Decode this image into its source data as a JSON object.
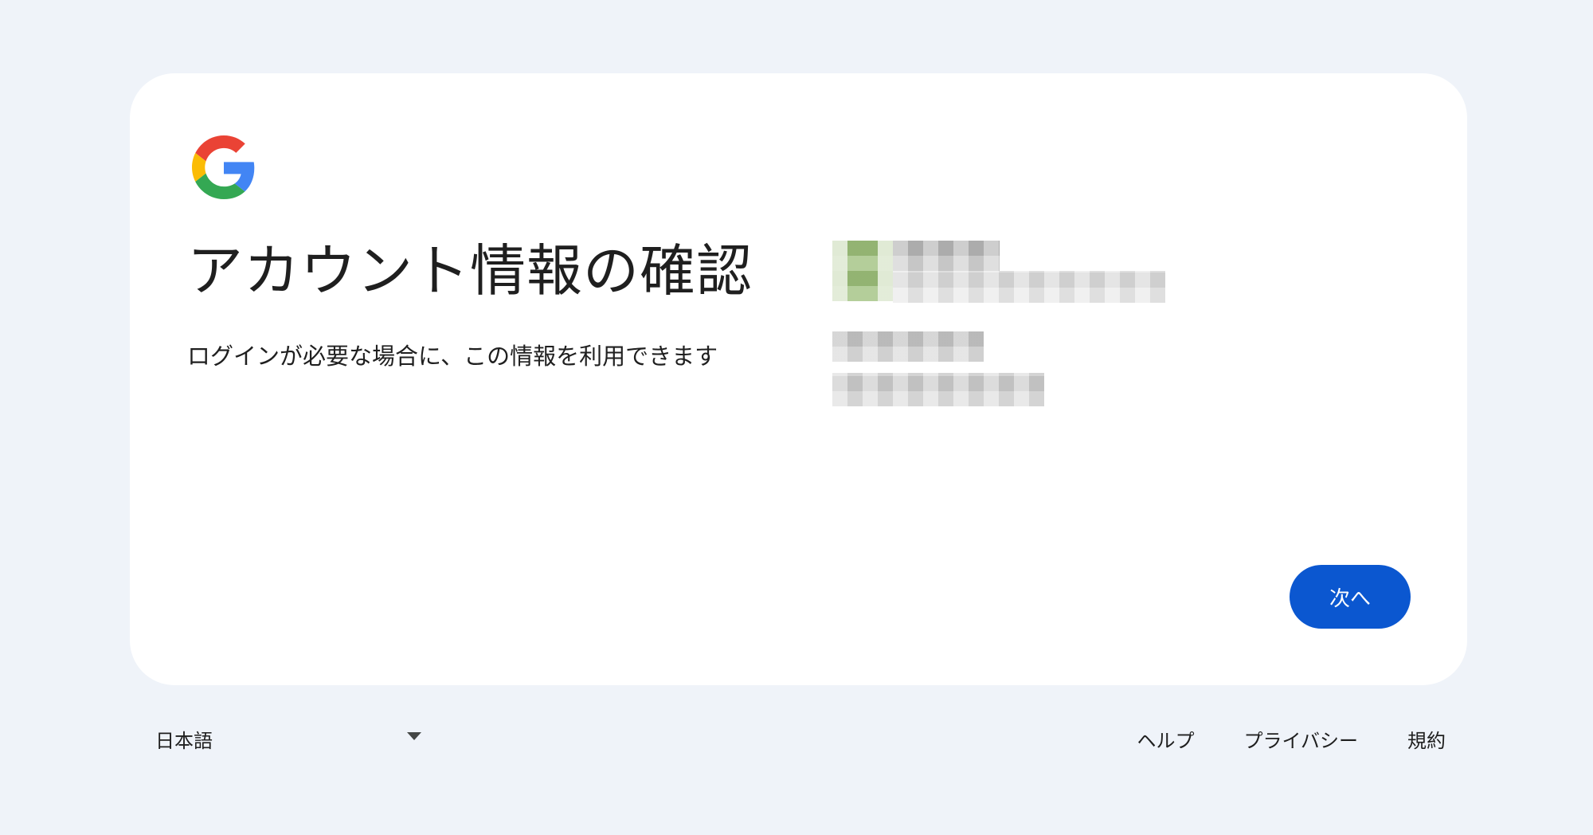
{
  "card": {
    "title": "アカウント情報の確認",
    "subtitle": "ログインが必要な場合に、この情報を利用できます"
  },
  "actions": {
    "next_label": "次へ"
  },
  "footer": {
    "language": "日本語",
    "links": [
      "ヘルプ",
      "プライバシー",
      "規約"
    ]
  },
  "colors": {
    "background": "#eff3f9",
    "card": "#ffffff",
    "primary_button": "#0b57d0",
    "text": "#1f1f1f"
  },
  "icons": {
    "logo": "google-g-icon",
    "language_dropdown": "caret-down-icon"
  }
}
